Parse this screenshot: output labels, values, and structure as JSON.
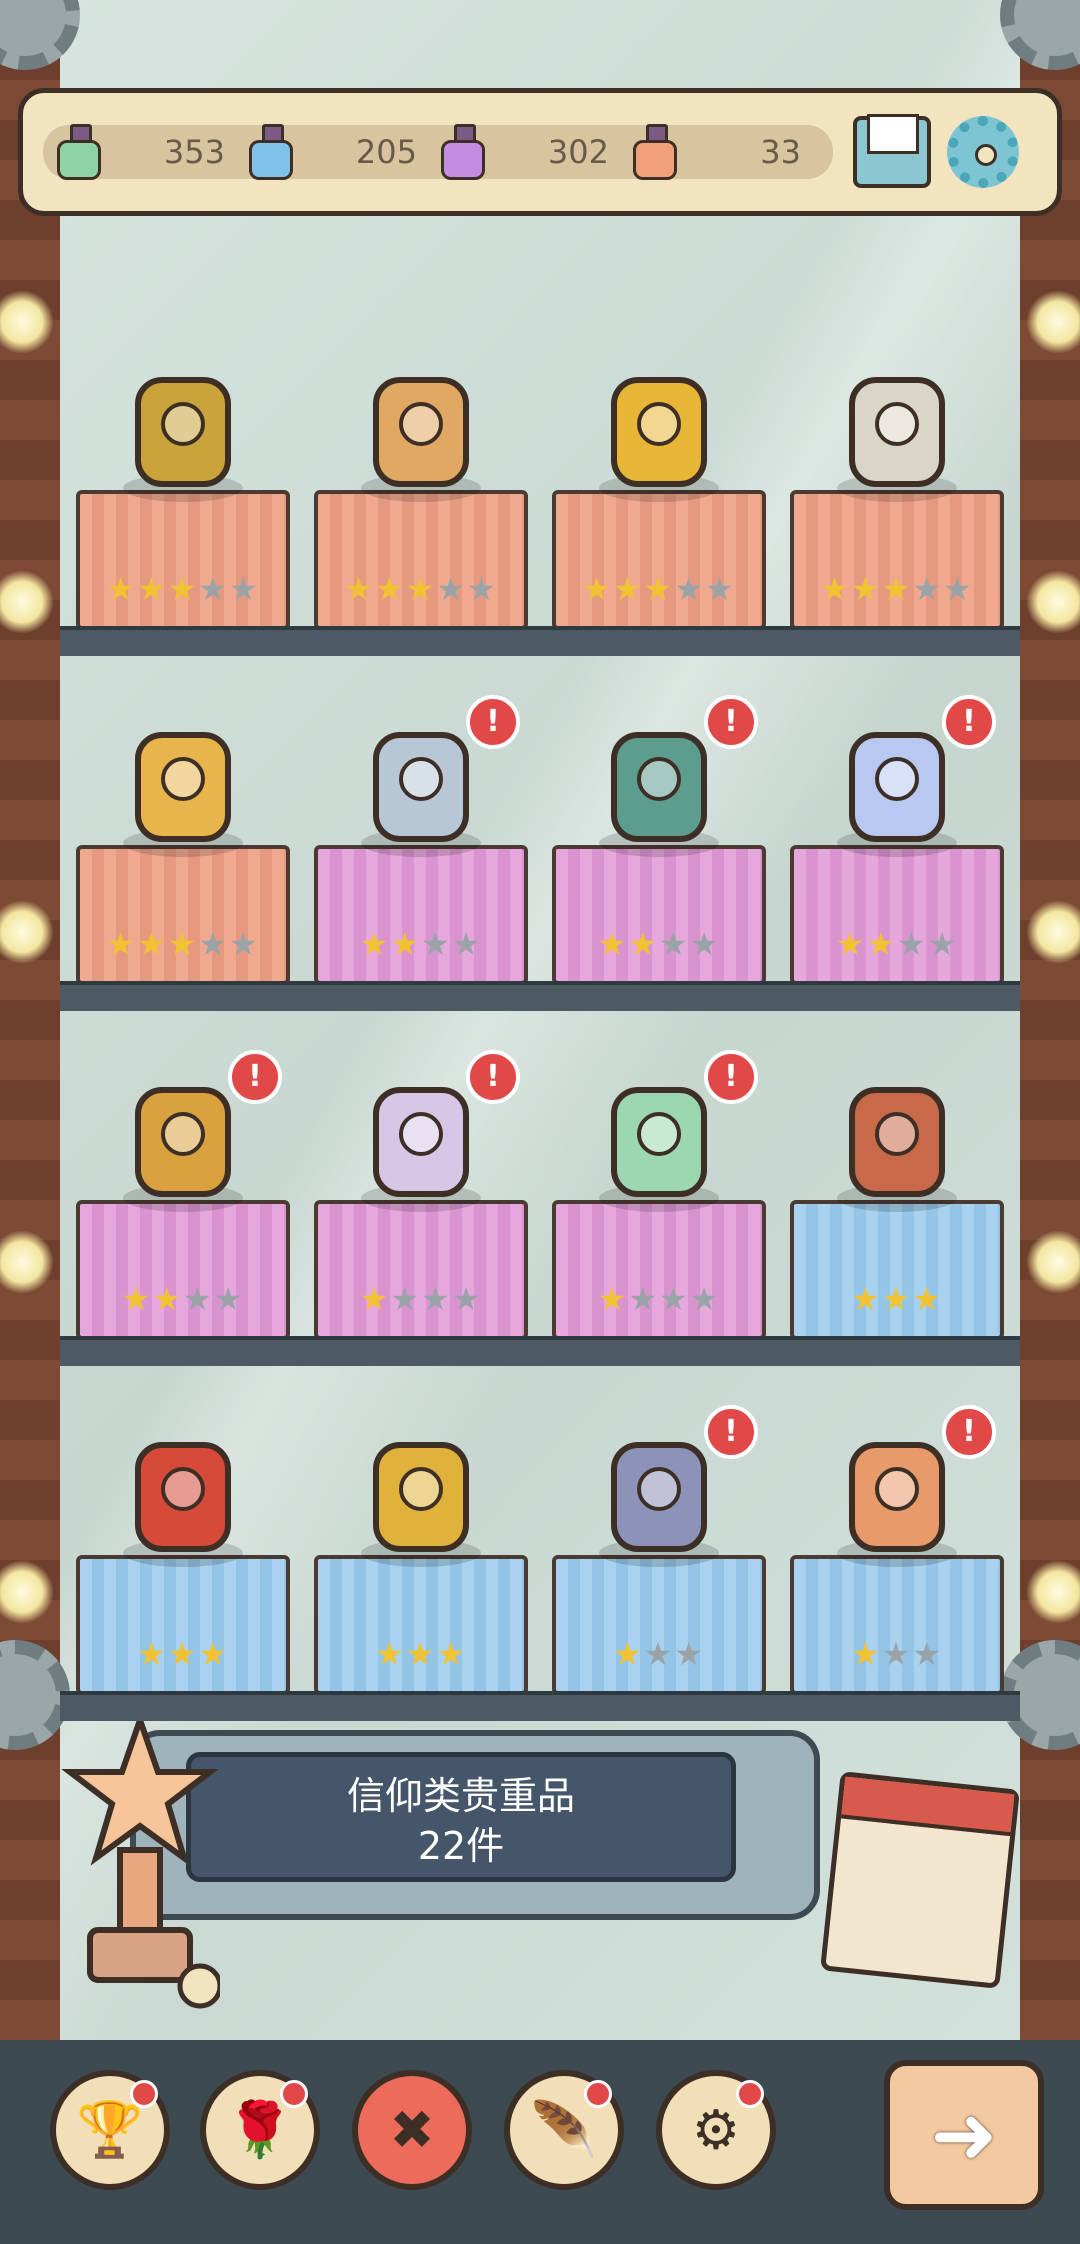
{
  "resources": [
    {
      "name": "green-potion",
      "color": "#8fd3a2",
      "value": "353"
    },
    {
      "name": "blue-potion",
      "color": "#7fc1e8",
      "value": "205"
    },
    {
      "name": "purple-potion",
      "color": "#c58de0",
      "value": "302"
    },
    {
      "name": "orange-potion",
      "color": "#f2a07c",
      "value": "33"
    }
  ],
  "shelves": [
    [
      {
        "item": "eye-amulet",
        "cloth": "orange",
        "stars": 3,
        "max": 5,
        "alert": false,
        "color": "#c9a43a"
      },
      {
        "item": "three-face-bust",
        "cloth": "orange",
        "stars": 3,
        "max": 5,
        "alert": false,
        "color": "#e0a862"
      },
      {
        "item": "golden-hand-statue",
        "cloth": "orange",
        "stars": 3,
        "max": 5,
        "alert": false,
        "color": "#e7b637"
      },
      {
        "item": "stone-tablet",
        "cloth": "orange",
        "stars": 3,
        "max": 5,
        "alert": false,
        "color": "#d9d6c9"
      }
    ],
    [
      {
        "item": "bread-basket",
        "cloth": "orange",
        "stars": 3,
        "max": 5,
        "alert": false,
        "color": "#e8b54d"
      },
      {
        "item": "sword-blade",
        "cloth": "pink",
        "stars": 2,
        "max": 4,
        "alert": true,
        "color": "#b8c7d6"
      },
      {
        "item": "totem-idol",
        "cloth": "pink",
        "stars": 2,
        "max": 4,
        "alert": true,
        "color": "#5d9d8e"
      },
      {
        "item": "perfume-bottle",
        "cloth": "pink",
        "stars": 2,
        "max": 4,
        "alert": true,
        "color": "#b9c8f0"
      }
    ],
    [
      {
        "item": "spinning-wheel",
        "cloth": "pink",
        "stars": 2,
        "max": 4,
        "alert": true,
        "color": "#d9a23f"
      },
      {
        "item": "thorn-pillow",
        "cloth": "pink",
        "stars": 1,
        "max": 4,
        "alert": true,
        "color": "#d8c6e6"
      },
      {
        "item": "glass-display-case",
        "cloth": "pink",
        "stars": 1,
        "max": 4,
        "alert": true,
        "color": "#9bd7b0"
      },
      {
        "item": "ornate-throne",
        "cloth": "blue",
        "stars": 3,
        "max": 3,
        "alert": false,
        "color": "#c86a4a"
      }
    ],
    [
      {
        "item": "icon-painting",
        "cloth": "blue",
        "stars": 3,
        "max": 3,
        "alert": false,
        "color": "#d64a3a"
      },
      {
        "item": "candelabra",
        "cloth": "blue",
        "stars": 3,
        "max": 3,
        "alert": false,
        "color": "#e0b23b"
      },
      {
        "item": "zodiac-disc",
        "cloth": "blue",
        "stars": 1,
        "max": 3,
        "alert": true,
        "color": "#8c92b8"
      },
      {
        "item": "fresco-fragment",
        "cloth": "blue",
        "stars": 1,
        "max": 3,
        "alert": true,
        "color": "#e79a6a"
      }
    ]
  ],
  "counter": {
    "title": "信仰类贵重品",
    "count": "22件"
  },
  "nav": [
    {
      "icon": "trophy-cup",
      "glyph": "🏆",
      "alert": true,
      "active": false
    },
    {
      "icon": "rose",
      "glyph": "🌹",
      "alert": true,
      "active": false
    },
    {
      "icon": "close-cross",
      "glyph": "✖",
      "alert": false,
      "active": true
    },
    {
      "icon": "feather-scroll",
      "glyph": "🪶",
      "alert": true,
      "active": false
    },
    {
      "icon": "gear",
      "glyph": "⚙",
      "alert": true,
      "active": false
    }
  ],
  "next": {
    "glyph": "➜"
  }
}
